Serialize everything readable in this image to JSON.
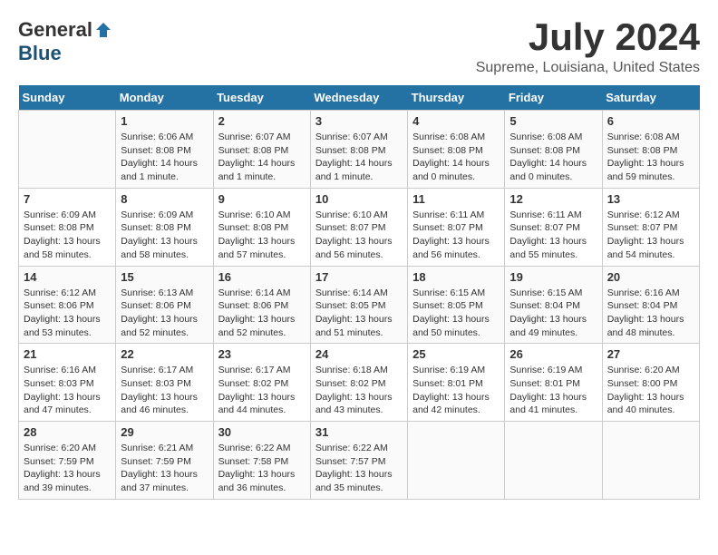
{
  "header": {
    "logo_general": "General",
    "logo_blue": "Blue",
    "main_title": "July 2024",
    "subtitle": "Supreme, Louisiana, United States"
  },
  "calendar": {
    "days_of_week": [
      "Sunday",
      "Monday",
      "Tuesday",
      "Wednesday",
      "Thursday",
      "Friday",
      "Saturday"
    ],
    "weeks": [
      [
        {
          "day": "",
          "empty": true
        },
        {
          "day": "1",
          "sunrise": "6:06 AM",
          "sunset": "8:08 PM",
          "daylight": "14 hours and 1 minute."
        },
        {
          "day": "2",
          "sunrise": "6:07 AM",
          "sunset": "8:08 PM",
          "daylight": "14 hours and 1 minute."
        },
        {
          "day": "3",
          "sunrise": "6:07 AM",
          "sunset": "8:08 PM",
          "daylight": "14 hours and 1 minute."
        },
        {
          "day": "4",
          "sunrise": "6:08 AM",
          "sunset": "8:08 PM",
          "daylight": "14 hours and 0 minutes."
        },
        {
          "day": "5",
          "sunrise": "6:08 AM",
          "sunset": "8:08 PM",
          "daylight": "14 hours and 0 minutes."
        },
        {
          "day": "6",
          "sunrise": "6:08 AM",
          "sunset": "8:08 PM",
          "daylight": "13 hours and 59 minutes."
        }
      ],
      [
        {
          "day": "7",
          "sunrise": "6:09 AM",
          "sunset": "8:08 PM",
          "daylight": "13 hours and 58 minutes."
        },
        {
          "day": "8",
          "sunrise": "6:09 AM",
          "sunset": "8:08 PM",
          "daylight": "13 hours and 58 minutes."
        },
        {
          "day": "9",
          "sunrise": "6:10 AM",
          "sunset": "8:08 PM",
          "daylight": "13 hours and 57 minutes."
        },
        {
          "day": "10",
          "sunrise": "6:10 AM",
          "sunset": "8:07 PM",
          "daylight": "13 hours and 56 minutes."
        },
        {
          "day": "11",
          "sunrise": "6:11 AM",
          "sunset": "8:07 PM",
          "daylight": "13 hours and 56 minutes."
        },
        {
          "day": "12",
          "sunrise": "6:11 AM",
          "sunset": "8:07 PM",
          "daylight": "13 hours and 55 minutes."
        },
        {
          "day": "13",
          "sunrise": "6:12 AM",
          "sunset": "8:07 PM",
          "daylight": "13 hours and 54 minutes."
        }
      ],
      [
        {
          "day": "14",
          "sunrise": "6:12 AM",
          "sunset": "8:06 PM",
          "daylight": "13 hours and 53 minutes."
        },
        {
          "day": "15",
          "sunrise": "6:13 AM",
          "sunset": "8:06 PM",
          "daylight": "13 hours and 52 minutes."
        },
        {
          "day": "16",
          "sunrise": "6:14 AM",
          "sunset": "8:06 PM",
          "daylight": "13 hours and 52 minutes."
        },
        {
          "day": "17",
          "sunrise": "6:14 AM",
          "sunset": "8:05 PM",
          "daylight": "13 hours and 51 minutes."
        },
        {
          "day": "18",
          "sunrise": "6:15 AM",
          "sunset": "8:05 PM",
          "daylight": "13 hours and 50 minutes."
        },
        {
          "day": "19",
          "sunrise": "6:15 AM",
          "sunset": "8:04 PM",
          "daylight": "13 hours and 49 minutes."
        },
        {
          "day": "20",
          "sunrise": "6:16 AM",
          "sunset": "8:04 PM",
          "daylight": "13 hours and 48 minutes."
        }
      ],
      [
        {
          "day": "21",
          "sunrise": "6:16 AM",
          "sunset": "8:03 PM",
          "daylight": "13 hours and 47 minutes."
        },
        {
          "day": "22",
          "sunrise": "6:17 AM",
          "sunset": "8:03 PM",
          "daylight": "13 hours and 46 minutes."
        },
        {
          "day": "23",
          "sunrise": "6:17 AM",
          "sunset": "8:02 PM",
          "daylight": "13 hours and 44 minutes."
        },
        {
          "day": "24",
          "sunrise": "6:18 AM",
          "sunset": "8:02 PM",
          "daylight": "13 hours and 43 minutes."
        },
        {
          "day": "25",
          "sunrise": "6:19 AM",
          "sunset": "8:01 PM",
          "daylight": "13 hours and 42 minutes."
        },
        {
          "day": "26",
          "sunrise": "6:19 AM",
          "sunset": "8:01 PM",
          "daylight": "13 hours and 41 minutes."
        },
        {
          "day": "27",
          "sunrise": "6:20 AM",
          "sunset": "8:00 PM",
          "daylight": "13 hours and 40 minutes."
        }
      ],
      [
        {
          "day": "28",
          "sunrise": "6:20 AM",
          "sunset": "7:59 PM",
          "daylight": "13 hours and 39 minutes."
        },
        {
          "day": "29",
          "sunrise": "6:21 AM",
          "sunset": "7:59 PM",
          "daylight": "13 hours and 37 minutes."
        },
        {
          "day": "30",
          "sunrise": "6:22 AM",
          "sunset": "7:58 PM",
          "daylight": "13 hours and 36 minutes."
        },
        {
          "day": "31",
          "sunrise": "6:22 AM",
          "sunset": "7:57 PM",
          "daylight": "13 hours and 35 minutes."
        },
        {
          "day": "",
          "empty": true
        },
        {
          "day": "",
          "empty": true
        },
        {
          "day": "",
          "empty": true
        }
      ]
    ]
  }
}
